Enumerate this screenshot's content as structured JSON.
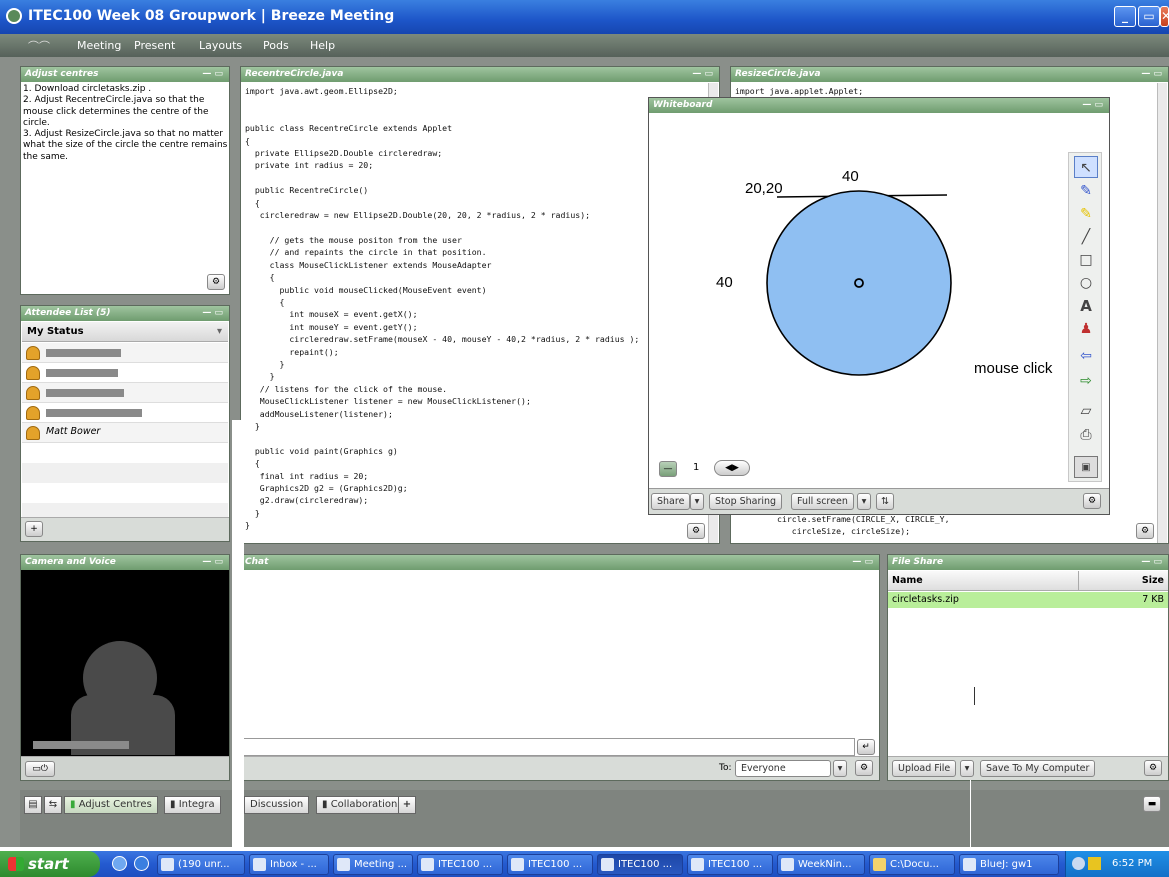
{
  "window": {
    "title": "ITEC100 Week 08 Groupwork | Breeze Meeting",
    "btn_min": "_",
    "btn_max": "▭",
    "btn_close": "✕"
  },
  "menu": {
    "items": [
      "Meeting",
      "Present",
      "Layouts",
      "Pods",
      "Help"
    ]
  },
  "adjust_pod": {
    "title": "Adjust centres",
    "lines": [
      "1. Download circletasks.zip .",
      "2. Adjust RecentreCircle.java so that the",
      "mouse click determines the centre of the",
      "circle.",
      "3. Adjust ResizeCircle.java so that no matter",
      "what the size of the circle the centre remains",
      "the same."
    ]
  },
  "recentre_pod": {
    "title": "RecentreCircle.java",
    "code": "import java.awt.geom.Ellipse2D;\n\n\npublic class RecentreCircle extends Applet\n{\n  private Ellipse2D.Double circleredraw;\n  private int radius = 20;\n\n  public RecentreCircle()\n  {\n   circleredraw = new Ellipse2D.Double(20, 20, 2 *radius, 2 * radius);\n\n     // gets the mouse positon from the user\n     // and repaints the circle in that position.\n     class MouseClickListener extends MouseAdapter\n     {\n       public void mouseClicked(MouseEvent event)\n       {\n         int mouseX = event.getX();\n         int mouseY = event.getY();\n         circleredraw.setFrame(mouseX - 40, mouseY - 40,2 *radius, 2 * radius );\n         repaint();\n       }\n     }\n   // listens for the click of the mouse.\n   MouseClickListener listener = new MouseClickListener();\n   addMouseListener(listener);\n  }\n\n  public void paint(Graphics g)\n  {\n   final int radius = 20;\n   Graphics2D g2 = (Graphics2D)g;\n   g2.draw(circleredraw);\n  }\n}"
  },
  "resize_pod": {
    "title": "ResizeCircle.java",
    "code_top": "import java.applet.Applet;",
    "code_bottom": "circle.setFrame(CIRCLE_X, CIRCLE_Y,\n   circleSize, circleSize);"
  },
  "whiteboard": {
    "title": "Whiteboard",
    "labels": {
      "coord": "20,20",
      "top": "40",
      "left": "40",
      "click": "mouse click"
    },
    "circle_fill": "#8fbff2",
    "page": "1",
    "share": "Share",
    "stop_sharing": "Stop Sharing",
    "full_screen": "Full screen",
    "tools": [
      "pointer-icon",
      "pen-icon",
      "highlighter-icon",
      "line-icon",
      "rectangle-icon",
      "ellipse-icon",
      "text-icon",
      "stamp-icon",
      "undo-icon",
      "redo-icon",
      "eraser-icon",
      "print-icon",
      "screen-icon"
    ]
  },
  "attendee_pod": {
    "title": "Attendee List (5)",
    "status_header": "My Status",
    "named_attendee": "Matt Bower"
  },
  "camera_pod": {
    "title": "Camera and Voice"
  },
  "chat_pod": {
    "title": "Chat",
    "to_label": "To:",
    "to_value": "Everyone"
  },
  "fileshare_pod": {
    "title": "File Share",
    "col_name": "Name",
    "col_size": "Size",
    "files": [
      {
        "name": "circletasks.zip",
        "size": "7 KB"
      }
    ],
    "upload": "Upload File",
    "save": "Save To My Computer"
  },
  "layout_tabs": [
    "Adjust Centres",
    "Integra",
    "Discussion",
    "Collaboration"
  ],
  "taskbar": {
    "start": "start",
    "buttons": [
      "(190 unr...",
      "Inbox - ...",
      "Meeting ...",
      "ITEC100 ...",
      "ITEC100 ...",
      "ITEC100 ...",
      "ITEC100 ...",
      "WeekNin...",
      "C:\\Docu...",
      "BlueJ: gw1"
    ],
    "time": "6:52 PM"
  }
}
